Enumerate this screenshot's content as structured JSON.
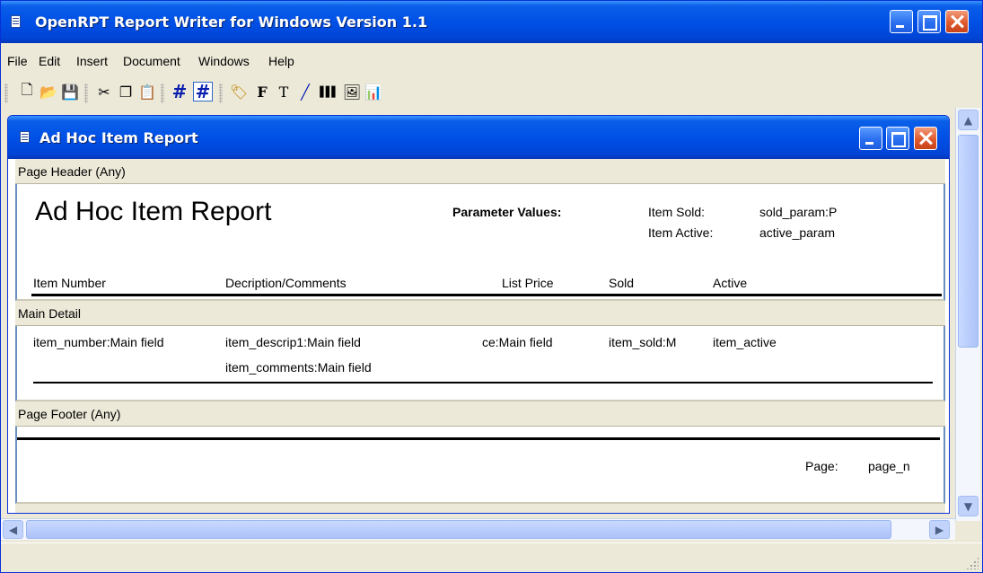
{
  "app": {
    "title": "OpenRPT Report Writer for Windows Version 1.1"
  },
  "menu": [
    "File",
    "Edit",
    "Insert",
    "Document",
    "Windows",
    "Help"
  ],
  "toolbar": {
    "buttons": [
      {
        "name": "new-document-icon",
        "glyph": "🗋"
      },
      {
        "name": "open-folder-icon",
        "glyph": "📂"
      },
      {
        "name": "save-icon",
        "glyph": "💾"
      },
      {
        "name": "cut-icon",
        "glyph": "✂"
      },
      {
        "name": "copy-icon",
        "glyph": "❐"
      },
      {
        "name": "paste-icon",
        "glyph": "📋"
      },
      {
        "name": "grid-icon",
        "glyph": "#"
      },
      {
        "name": "snap-grid-icon",
        "glyph": "#"
      },
      {
        "name": "label-icon",
        "glyph": "🏷"
      },
      {
        "name": "field-icon",
        "glyph": "F"
      },
      {
        "name": "text-icon",
        "glyph": "T"
      },
      {
        "name": "line-icon",
        "glyph": "╱"
      },
      {
        "name": "barcode-icon",
        "glyph": "▌▌▌"
      },
      {
        "name": "image-icon",
        "glyph": "🖼"
      },
      {
        "name": "graph-icon",
        "glyph": "📊"
      }
    ]
  },
  "child_window": {
    "title": "Ad Hoc Item Report"
  },
  "sections": {
    "page_header": {
      "label": "Page Header (Any)",
      "title": "Ad Hoc Item Report",
      "param_heading": "Parameter Values:",
      "param_labels": [
        "Item Sold:",
        "Item Active:"
      ],
      "param_values": [
        "sold_param:P",
        "active_param"
      ],
      "columns": [
        "Item Number",
        "Decription/Comments",
        "List Price",
        "Sold",
        "Active"
      ]
    },
    "main_detail": {
      "label": "Main Detail",
      "fields": [
        "item_number:Main field",
        "item_descrip1:Main field",
        "ce:Main field",
        "item_sold:M",
        "item_active"
      ],
      "comments_field": "item_comments:Main field"
    },
    "page_footer": {
      "label": "Page Footer (Any)",
      "page_label": "Page:",
      "page_field": "page_n"
    }
  }
}
